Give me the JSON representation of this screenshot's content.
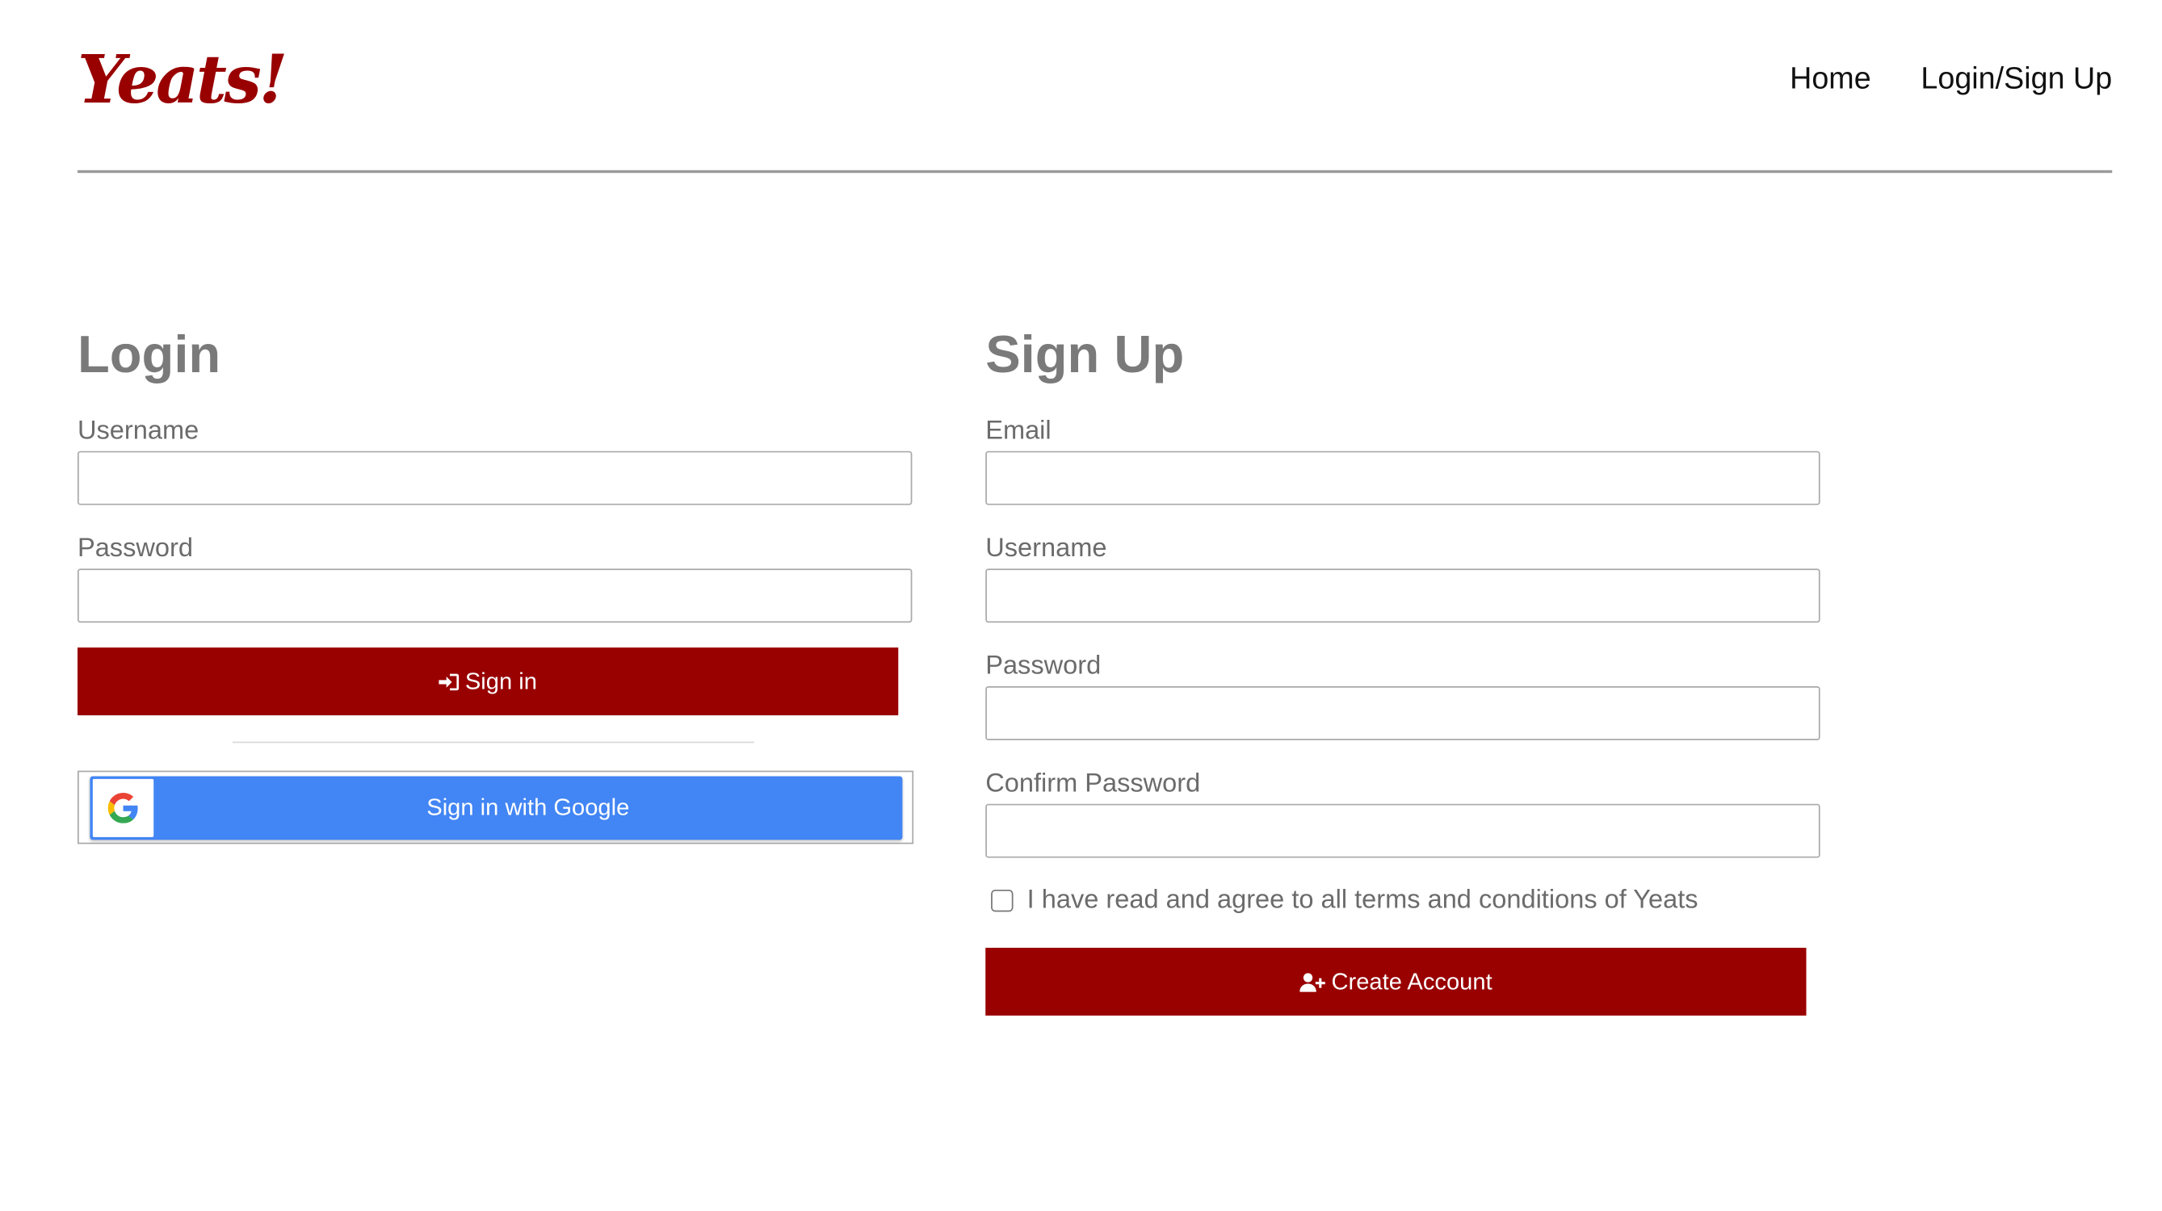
{
  "header": {
    "logo": "Yeats!",
    "nav": [
      {
        "label": "Home"
      },
      {
        "label": "Login/Sign Up"
      }
    ]
  },
  "login": {
    "title": "Login",
    "username_label": "Username",
    "username_value": "",
    "password_label": "Password",
    "password_value": "",
    "sign_in_label": "Sign in",
    "sign_in_icon": "sign-in-icon",
    "google_label": "Sign in with Google",
    "google_icon": "google-g-icon"
  },
  "signup": {
    "title": "Sign Up",
    "email_label": "Email",
    "email_value": "",
    "username_label": "Username",
    "username_value": "",
    "password_label": "Password",
    "password_value": "",
    "confirm_label": "Confirm Password",
    "confirm_value": "",
    "terms_text": "I have read and agree to all terms and conditions of Yeats",
    "terms_checked": false,
    "create_label": "Create Account",
    "create_icon": "user-plus-icon"
  },
  "colors": {
    "brand": "#990000",
    "google_blue": "#4285f4",
    "label_gray": "#6b6b6b",
    "title_gray": "#7a7a7a"
  }
}
